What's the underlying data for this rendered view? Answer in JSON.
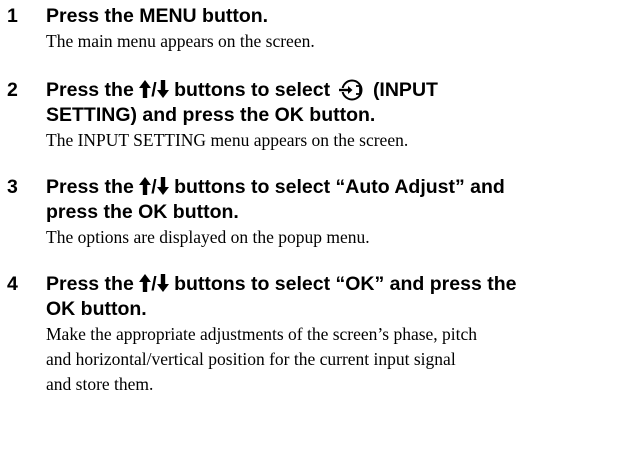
{
  "steps": [
    {
      "number": "1",
      "title": "Press the MENU button.",
      "description": "The main menu appears on the screen."
    },
    {
      "number": "2",
      "title_prefix": "Press the",
      "title_buttons": "buttons to select",
      "title_line1_end": "(INPUT",
      "title_line2": "SETTING) and press the OK button.",
      "icon": "input-setting-icon",
      "description": "The INPUT SETTING menu appears on the screen."
    },
    {
      "number": "3",
      "title_prefix": "Press the",
      "title_line1_rest": "buttons to select “Auto Adjust” and",
      "title_line2": "press the OK button.",
      "description": "The options are displayed on the popup menu."
    },
    {
      "number": "4",
      "title_prefix": "Press the",
      "title_line1_rest": "buttons to select “OK” and press the",
      "title_line2": "OK button.",
      "description_lines": [
        "Make the appropriate adjustments of the screen’s phase, pitch",
        "and horizontal/vertical position for the current input signal",
        "and store them."
      ]
    }
  ],
  "arrow_separator": "/",
  "icons": {
    "up_arrow": "up-arrow-icon",
    "down_arrow": "down-arrow-icon",
    "input_setting": "input-setting-icon"
  }
}
